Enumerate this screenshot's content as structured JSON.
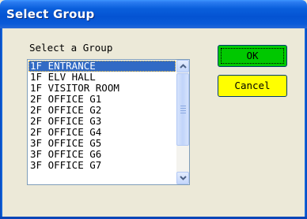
{
  "window": {
    "title": "Select Group"
  },
  "group_list": {
    "label": "Select a Group",
    "items": [
      {
        "label": "1F ENTRANCE",
        "selected": true
      },
      {
        "label": "1F ELV HALL",
        "selected": false
      },
      {
        "label": "1F VISITOR ROOM",
        "selected": false
      },
      {
        "label": "2F OFFICE G1",
        "selected": false
      },
      {
        "label": "2F OFFICE G2",
        "selected": false
      },
      {
        "label": "2F OFFICE G3",
        "selected": false
      },
      {
        "label": "2F OFFICE G4",
        "selected": false
      },
      {
        "label": "3F OFFICE G5",
        "selected": false
      },
      {
        "label": "3F OFFICE G6",
        "selected": false
      },
      {
        "label": "3F OFFICE G7",
        "selected": false
      }
    ],
    "selected_color": "#316ac5"
  },
  "buttons": {
    "ok_label": "OK",
    "ok_color": "#00c800",
    "cancel_label": "Cancel",
    "cancel_color": "#ffff00"
  },
  "icons": {
    "scroll_up": "scroll-up-arrow-icon",
    "scroll_down": "scroll-down-arrow-icon"
  }
}
